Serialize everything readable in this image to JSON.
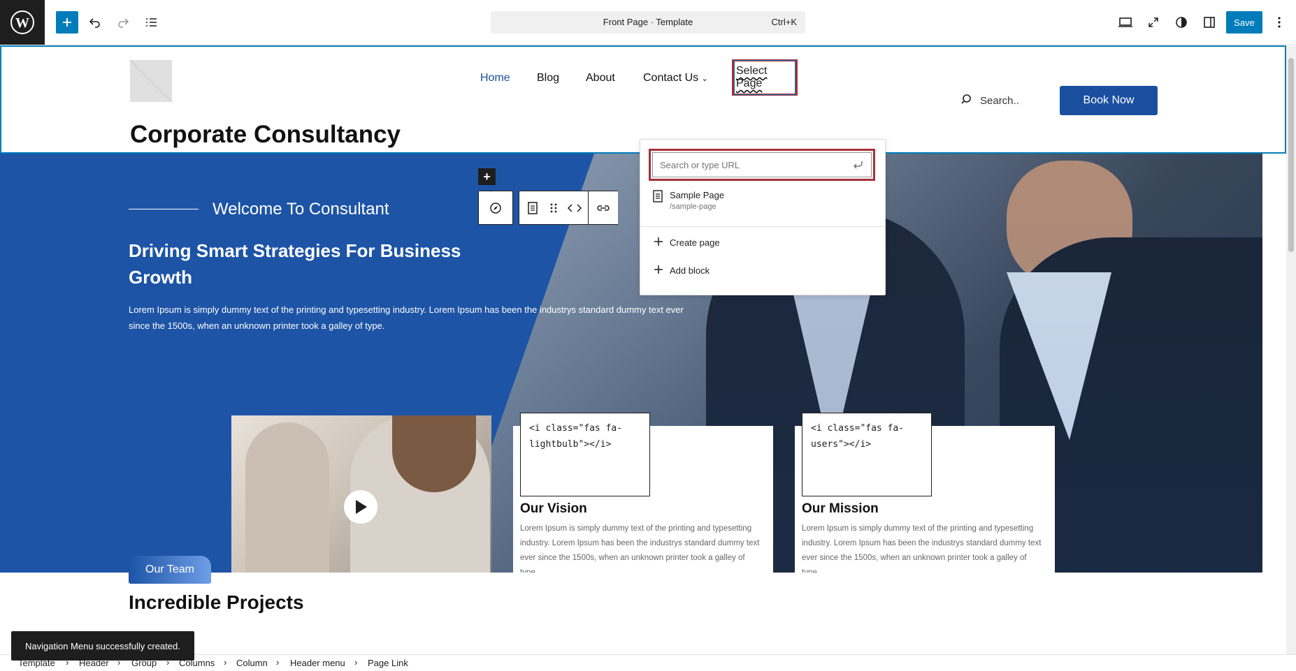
{
  "editor": {
    "command_title": "Front Page · Template",
    "command_shortcut": "Ctrl+K",
    "save_label": "Save"
  },
  "header": {
    "site_title": "Corporate Consultancy",
    "nav": [
      "Home",
      "Blog",
      "About",
      "Contact Us",
      "Select Page"
    ],
    "search_label": "Search..",
    "book_label": "Book Now"
  },
  "link_popover": {
    "placeholder": "Search or type URL",
    "suggestion_title": "Sample Page",
    "suggestion_slug": "/sample-page",
    "create_label": "Create page",
    "add_label": "Add block"
  },
  "hero": {
    "welcome": "Welcome To Consultant",
    "heading": "Driving Smart Strategies For Business Growth",
    "paragraph": "Lorem Ipsum is simply dummy text of the printing and typesetting industry. Lorem Ipsum has been the industrys standard dummy text ever since the 1500s, when an unknown printer took a galley of type."
  },
  "cards": [
    {
      "code": "<i class=\"fas fa-lightbulb\"></i>",
      "title": "Our Vision",
      "text": "Lorem Ipsum is simply dummy text of the printing and typesetting industry. Lorem Ipsum has been the industrys standard dummy text ever since the 1500s, when an unknown printer took a galley of type."
    },
    {
      "code": "<i class=\"fas fa-users\"></i>",
      "title": "Our Mission",
      "text": "Lorem Ipsum is simply dummy text of the printing and typesetting industry. Lorem Ipsum has been the industrys standard dummy text ever since the 1500s, when an unknown printer took a galley of type."
    }
  ],
  "team_label": "Our Team",
  "projects_heading": "Incredible Projects",
  "snackbar": "Navigation Menu successfully created.",
  "breadcrumbs": [
    "Template",
    "Header",
    "Group",
    "Columns",
    "Column",
    "Header menu",
    "Page Link"
  ],
  "colors": {
    "accent": "#007cba",
    "brand_blue": "#1d54a6",
    "highlight": "#a5303a"
  }
}
